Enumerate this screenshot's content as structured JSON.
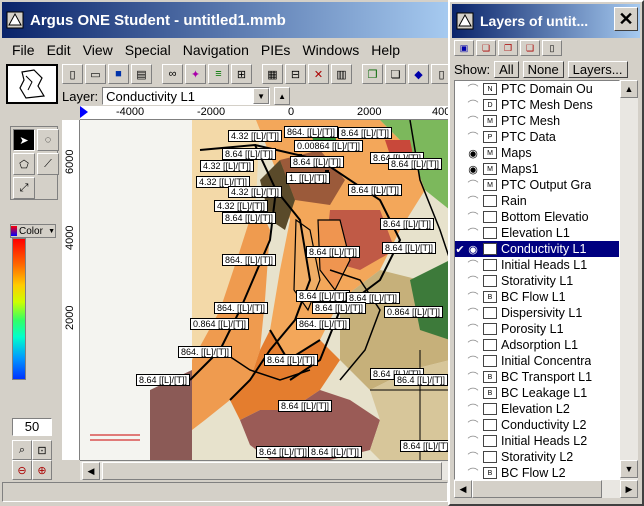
{
  "main_window": {
    "title": "Argus ONE Student - untitled1.mmb",
    "menu": [
      "File",
      "Edit",
      "View",
      "Special",
      "Navigation",
      "PIEs",
      "Windows",
      "Help"
    ]
  },
  "layer_selector": {
    "label": "Layer:",
    "value": "Conductivity L1"
  },
  "palette": {
    "color_label": "Color"
  },
  "zoom": {
    "value": "50"
  },
  "ruler": {
    "x_ticks": [
      "-4000",
      "-2000",
      "0",
      "2000",
      "4000"
    ],
    "y_ticks": [
      "6000",
      "4000",
      "2000"
    ]
  },
  "map_labels": [
    "4.32 [[L]/[T]]",
    "864. [[L]/[T]]",
    "8.64 [[L]/[T]]",
    "8.64 [[L]/[T]]",
    "4.32 [[L]/[T]]",
    "0.00864 [[L]/[T]]",
    "8.64 [[L]/[T]]",
    "4.32 [[L]/[T]]",
    "1. [[L]/[T]]",
    "8.64 [[L]/[T]]",
    "4.32 [[L]/[T]]",
    "8.64 [[L]/[T]]",
    "8.64 [[L]/[T]]",
    "864. [[L]/[T]]",
    "8.64 [[L]/[T]]",
    "8.64 [[L]/[T]]",
    "864. [[L]/[T]]",
    "8.64 [[L]/[T]]",
    "864. [[L]/[T]]",
    "8.64 [[L]/[T]]",
    "8.64 [[L]/[T]]",
    "0.864 [[L]/[T]]",
    "0.864 [[L]/[T]]",
    "864. [[L]/[T]]",
    "8.64 [[L]/[T]]",
    "8.64 [[L]/[T]]",
    "8.64 [[L]/[T]]",
    "8.64 [[L]/[T]]",
    "86.4 [[L]/[T]]",
    "8.64 [[L]/[T]]",
    "8.64 [[L]/[T]]",
    "8.64 [[L]/[T]]",
    "8.64 [[L]/[T]]",
    "8.64 [[L]/[T]]",
    "4.32 [[L]/[T]]"
  ],
  "layers_window": {
    "title": "Layers of untit...",
    "show_label": "Show:",
    "buttons": [
      "All",
      "None",
      "Layers..."
    ],
    "layers": [
      {
        "name": "PTC Domain Ou",
        "visible": false,
        "icon": "N"
      },
      {
        "name": "PTC Mesh Dens",
        "visible": false,
        "icon": "D"
      },
      {
        "name": "PTC Mesh",
        "visible": false,
        "icon": "M"
      },
      {
        "name": "PTC Data",
        "visible": false,
        "icon": "P"
      },
      {
        "name": "Maps",
        "visible": true,
        "icon": "M"
      },
      {
        "name": "Maps1",
        "visible": true,
        "icon": "M"
      },
      {
        "name": "PTC Output Gra",
        "visible": false,
        "icon": "M"
      },
      {
        "name": "Rain",
        "visible": false,
        "icon": ""
      },
      {
        "name": "Bottom Elevatio",
        "visible": false,
        "icon": ""
      },
      {
        "name": "Elevation L1",
        "visible": false,
        "icon": ""
      },
      {
        "name": "Conductivity L1",
        "visible": true,
        "icon": "",
        "selected": true
      },
      {
        "name": "Initial Heads L1",
        "visible": false,
        "icon": ""
      },
      {
        "name": "Storativity L1",
        "visible": false,
        "icon": ""
      },
      {
        "name": "BC Flow L1",
        "visible": false,
        "icon": "B"
      },
      {
        "name": "Dispersivity L1",
        "visible": false,
        "icon": ""
      },
      {
        "name": "Porosity L1",
        "visible": false,
        "icon": ""
      },
      {
        "name": "Adsorption L1",
        "visible": false,
        "icon": ""
      },
      {
        "name": "Initial Concentra",
        "visible": false,
        "icon": ""
      },
      {
        "name": "BC Transport L1",
        "visible": false,
        "icon": "B"
      },
      {
        "name": "BC Leakage L1",
        "visible": false,
        "icon": "B"
      },
      {
        "name": "Elevation L2",
        "visible": false,
        "icon": ""
      },
      {
        "name": "Conductivity L2",
        "visible": false,
        "icon": ""
      },
      {
        "name": "Initial Heads L2",
        "visible": false,
        "icon": ""
      },
      {
        "name": "Storativity L2",
        "visible": false,
        "icon": ""
      },
      {
        "name": "BC Flow L2",
        "visible": false,
        "icon": "B"
      }
    ]
  }
}
